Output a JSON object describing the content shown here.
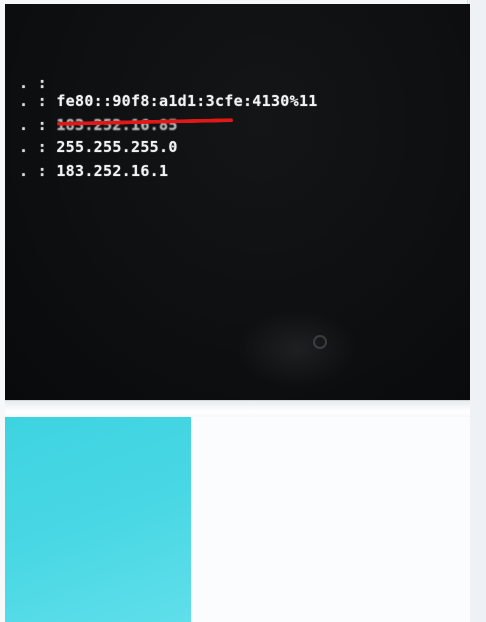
{
  "terminal": {
    "lines": [
      {
        "dots": ". :",
        "value": ""
      },
      {
        "dots": ". :",
        "value": "fe80::90f8:a1d1:3cfe:4130%11"
      },
      {
        "dots": ". :",
        "value": "183.252.16.85"
      },
      {
        "dots": ". :",
        "value": "255.255.255.0"
      },
      {
        "dots": ". :",
        "value": "183.252.16.1"
      }
    ]
  },
  "colors": {
    "terminal_background": "#0d0f11",
    "text": "#f2f2f2",
    "redaction_mark": "#e01818",
    "desktop_cyan": "#48d7e4",
    "desktop_white": "#fbfcfd"
  }
}
